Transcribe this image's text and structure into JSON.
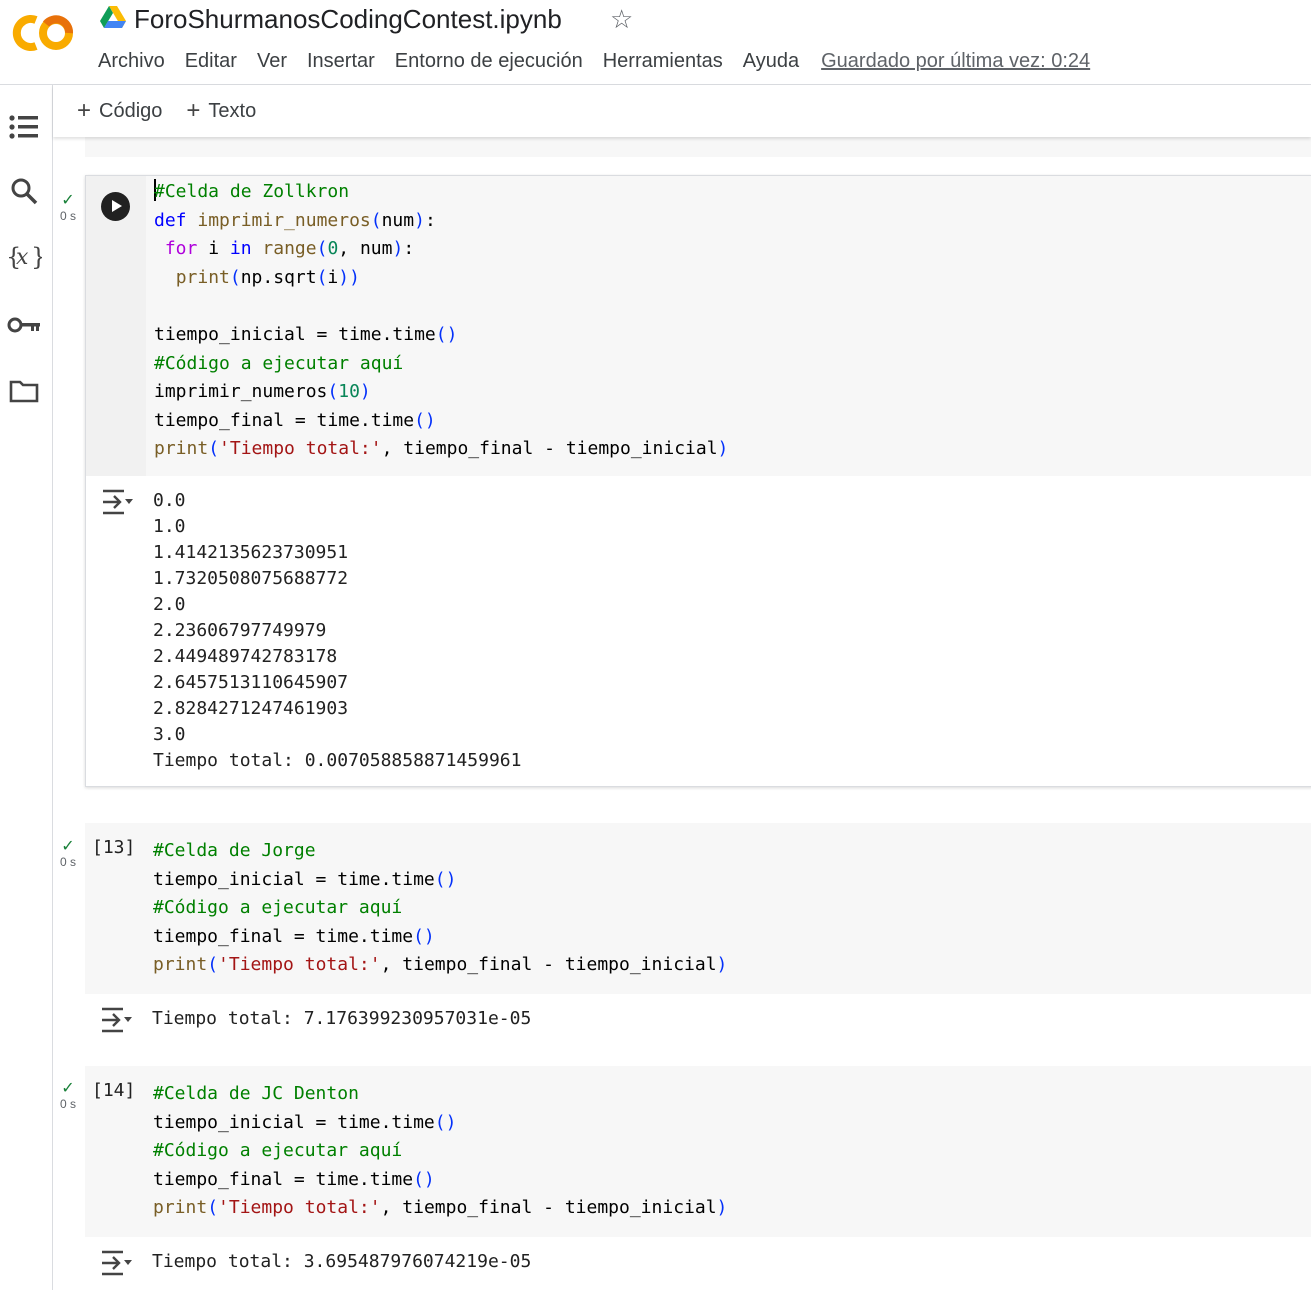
{
  "header": {
    "notebook_title": "ForoShurmanosCodingContest.ipynb",
    "menu": [
      "Archivo",
      "Editar",
      "Ver",
      "Insertar",
      "Entorno de ejecución",
      "Herramientas",
      "Ayuda"
    ],
    "saved_status": "Guardado por última vez: 0:24"
  },
  "toolbar": {
    "code_label": "Código",
    "text_label": "Texto",
    "plus": "+"
  },
  "rail": {
    "icons": [
      "table-of-contents-icon",
      "search-icon",
      "variables-icon",
      "secrets-key-icon",
      "files-folder-icon"
    ]
  },
  "colors": {
    "brand_orange": "#F9AB00",
    "check_green": "#188038"
  },
  "cells": [
    {
      "exec_status": "✓",
      "exec_time": "0 s",
      "code": [
        "#Celda de Zollkron",
        "def imprimir_numeros(num):",
        " for i in range(0, num):",
        "  print(np.sqrt(i))",
        "",
        "tiempo_inicial = time.time()",
        "#Código a ejecutar aquí",
        "imprimir_numeros(10)",
        "tiempo_final = time.time()",
        "print('Tiempo total:', tiempo_final - tiempo_inicial)"
      ],
      "output": [
        "0.0",
        "1.0",
        "1.4142135623730951",
        "1.7320508075688772",
        "2.0",
        "2.23606797749979",
        "2.449489742783178",
        "2.6457513110645907",
        "2.8284271247461903",
        "3.0",
        "Tiempo total: 0.0070588588714599 61"
      ]
    },
    {
      "exec_status": "✓",
      "exec_time": "0 s",
      "exec_count": "[13]",
      "code": [
        "#Celda de Jorge",
        "tiempo_inicial = time.time()",
        "#Código a ejecutar aquí",
        "tiempo_final = time.time()",
        "print('Tiempo total:', tiempo_final - tiempo_inicial)"
      ],
      "output": [
        "Tiempo total: 7.176399230957031e-05"
      ]
    },
    {
      "exec_status": "✓",
      "exec_time": "0 s",
      "exec_count": "[14]",
      "code": [
        "#Celda de JC Denton",
        "tiempo_inicial = time.time()",
        "#Código a ejecutar aquí",
        "tiempo_final = time.time()",
        "print('Tiempo total:', tiempo_final - tiempo_inicial)"
      ],
      "output": [
        "Tiempo total: 3.695487976074219e-05"
      ]
    }
  ]
}
